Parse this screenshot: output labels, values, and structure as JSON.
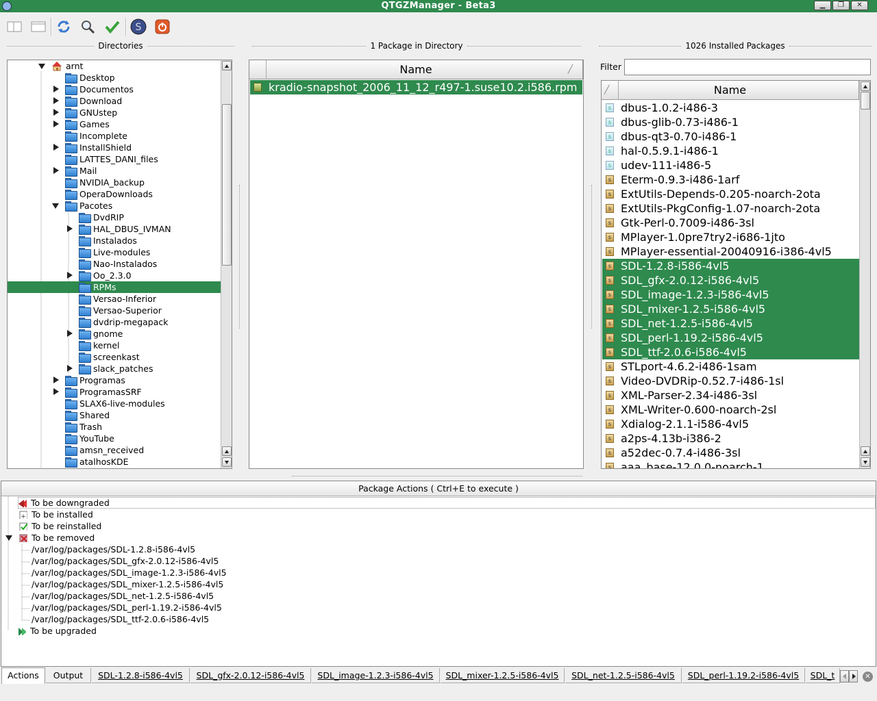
{
  "window": {
    "title": "QTGZManager - Beta3"
  },
  "headers": {
    "directories": "Directories",
    "package_count": "1 Package in Directory",
    "installed_count": "1026 Installed Packages"
  },
  "tree": {
    "root": "arnt",
    "items": [
      {
        "label": "Desktop",
        "level": 1,
        "expander": "none"
      },
      {
        "label": "Documentos",
        "level": 1,
        "expander": "collapsed"
      },
      {
        "label": "Download",
        "level": 1,
        "expander": "collapsed"
      },
      {
        "label": "GNUstep",
        "level": 1,
        "expander": "collapsed"
      },
      {
        "label": "Games",
        "level": 1,
        "expander": "collapsed"
      },
      {
        "label": "Incomplete",
        "level": 1,
        "expander": "none"
      },
      {
        "label": "InstallShield",
        "level": 1,
        "expander": "collapsed"
      },
      {
        "label": "LATTES_DANI_files",
        "level": 1,
        "expander": "none"
      },
      {
        "label": "Mail",
        "level": 1,
        "expander": "collapsed"
      },
      {
        "label": "NVIDIA_backup",
        "level": 1,
        "expander": "none"
      },
      {
        "label": "OperaDownloads",
        "level": 1,
        "expander": "none"
      },
      {
        "label": "Pacotes",
        "level": 1,
        "expander": "expanded"
      },
      {
        "label": "DvdRIP",
        "level": 2,
        "expander": "none"
      },
      {
        "label": "HAL_DBUS_IVMAN",
        "level": 2,
        "expander": "collapsed"
      },
      {
        "label": "Instalados",
        "level": 2,
        "expander": "none"
      },
      {
        "label": "Live-modules",
        "level": 2,
        "expander": "none"
      },
      {
        "label": "Nao-Instalados",
        "level": 2,
        "expander": "none"
      },
      {
        "label": "Oo_2.3.0",
        "level": 2,
        "expander": "collapsed"
      },
      {
        "label": "RPMs",
        "level": 2,
        "expander": "none",
        "selected": true
      },
      {
        "label": "Versao-Inferior",
        "level": 2,
        "expander": "none"
      },
      {
        "label": "Versao-Superior",
        "level": 2,
        "expander": "none"
      },
      {
        "label": "dvdrip-megapack",
        "level": 2,
        "expander": "none"
      },
      {
        "label": "gnome",
        "level": 2,
        "expander": "collapsed"
      },
      {
        "label": "kernel",
        "level": 2,
        "expander": "none"
      },
      {
        "label": "screenkast",
        "level": 2,
        "expander": "none"
      },
      {
        "label": "slack_patches",
        "level": 2,
        "expander": "collapsed"
      },
      {
        "label": "Programas",
        "level": 1,
        "expander": "collapsed"
      },
      {
        "label": "ProgramasSRF",
        "level": 1,
        "expander": "collapsed"
      },
      {
        "label": "SLAX6-live-modules",
        "level": 1,
        "expander": "none"
      },
      {
        "label": "Shared",
        "level": 1,
        "expander": "none"
      },
      {
        "label": "Trash",
        "level": 1,
        "expander": "none"
      },
      {
        "label": "YouTube",
        "level": 1,
        "expander": "none"
      },
      {
        "label": "amsn_received",
        "level": 1,
        "expander": "none"
      },
      {
        "label": "atalhosKDE",
        "level": 1,
        "expander": "none"
      }
    ]
  },
  "directory_packages": {
    "column": "Name",
    "items": [
      "kradio-snapshot_2006_11_12_r497-1.suse10.2.i586.rpm"
    ]
  },
  "installed": {
    "filter_label": "Filter",
    "filter_value": "",
    "column": "Name",
    "items": [
      {
        "name": "dbus-1.0.2-i486-3",
        "icon": "blue"
      },
      {
        "name": "dbus-glib-0.73-i486-1",
        "icon": "blue"
      },
      {
        "name": "dbus-qt3-0.70-i486-1",
        "icon": "blue"
      },
      {
        "name": "hal-0.5.9.1-i486-1",
        "icon": "blue"
      },
      {
        "name": "udev-111-i486-5",
        "icon": "blue"
      },
      {
        "name": "Eterm-0.9.3-i486-1arf",
        "icon": "brown"
      },
      {
        "name": "ExtUtils-Depends-0.205-noarch-2ota",
        "icon": "brown"
      },
      {
        "name": "ExtUtils-PkgConfig-1.07-noarch-2ota",
        "icon": "brown"
      },
      {
        "name": "Gtk-Perl-0.7009-i486-3sl",
        "icon": "brown"
      },
      {
        "name": "MPlayer-1.0pre7try2-i686-1jto",
        "icon": "brown"
      },
      {
        "name": "MPlayer-essential-20040916-i386-4vl5",
        "icon": "brown"
      },
      {
        "name": "SDL-1.2.8-i586-4vl5",
        "icon": "brown",
        "selected": true
      },
      {
        "name": "SDL_gfx-2.0.12-i586-4vl5",
        "icon": "brown",
        "selected": true
      },
      {
        "name": "SDL_image-1.2.3-i586-4vl5",
        "icon": "brown",
        "selected": true
      },
      {
        "name": "SDL_mixer-1.2.5-i586-4vl5",
        "icon": "brown",
        "selected": true
      },
      {
        "name": "SDL_net-1.2.5-i586-4vl5",
        "icon": "brown",
        "selected": true
      },
      {
        "name": "SDL_perl-1.19.2-i586-4vl5",
        "icon": "brown",
        "selected": true
      },
      {
        "name": "SDL_ttf-2.0.6-i586-4vl5",
        "icon": "brown",
        "selected": true
      },
      {
        "name": "STLport-4.6.2-i486-1sam",
        "icon": "brown"
      },
      {
        "name": "Video-DVDRip-0.52.7-i486-1sl",
        "icon": "brown"
      },
      {
        "name": "XML-Parser-2.34-i486-3sl",
        "icon": "brown"
      },
      {
        "name": "XML-Writer-0.600-noarch-2sl",
        "icon": "brown"
      },
      {
        "name": "Xdialog-2.1.1-i586-4vl5",
        "icon": "brown"
      },
      {
        "name": "a2ps-4.13b-i386-2",
        "icon": "brown"
      },
      {
        "name": "a52dec-0.7.4-i486-3sl",
        "icon": "brown"
      },
      {
        "name": "aaa_base-12.0.0-noarch-1",
        "icon": "brown"
      }
    ]
  },
  "actions": {
    "header": "Package Actions ( Ctrl+E to execute )",
    "groups": {
      "downgrade": "To be downgraded",
      "install": "To be installed",
      "reinstall": "To be reinstalled",
      "remove": "To be removed",
      "upgrade": "To be upgraded"
    },
    "remove_items": [
      "/var/log/packages/SDL-1.2.8-i586-4vl5",
      "/var/log/packages/SDL_gfx-2.0.12-i586-4vl5",
      "/var/log/packages/SDL_image-1.2.3-i586-4vl5",
      "/var/log/packages/SDL_mixer-1.2.5-i586-4vl5",
      "/var/log/packages/SDL_net-1.2.5-i586-4vl5",
      "/var/log/packages/SDL_perl-1.19.2-i586-4vl5",
      "/var/log/packages/SDL_ttf-2.0.6-i586-4vl5"
    ]
  },
  "tabs": [
    "Actions",
    "Output",
    "SDL-1.2.8-i586-4vl5",
    "SDL_gfx-2.0.12-i586-4vl5",
    "SDL_image-1.2.3-i586-4vl5",
    "SDL_mixer-1.2.5-i586-4vl5",
    "SDL_net-1.2.5-i586-4vl5",
    "SDL_perl-1.19.2-i586-4vl5",
    "SDL_t"
  ],
  "colors": {
    "accent": "#2f8a4e",
    "selection": "#2f8a4e"
  }
}
